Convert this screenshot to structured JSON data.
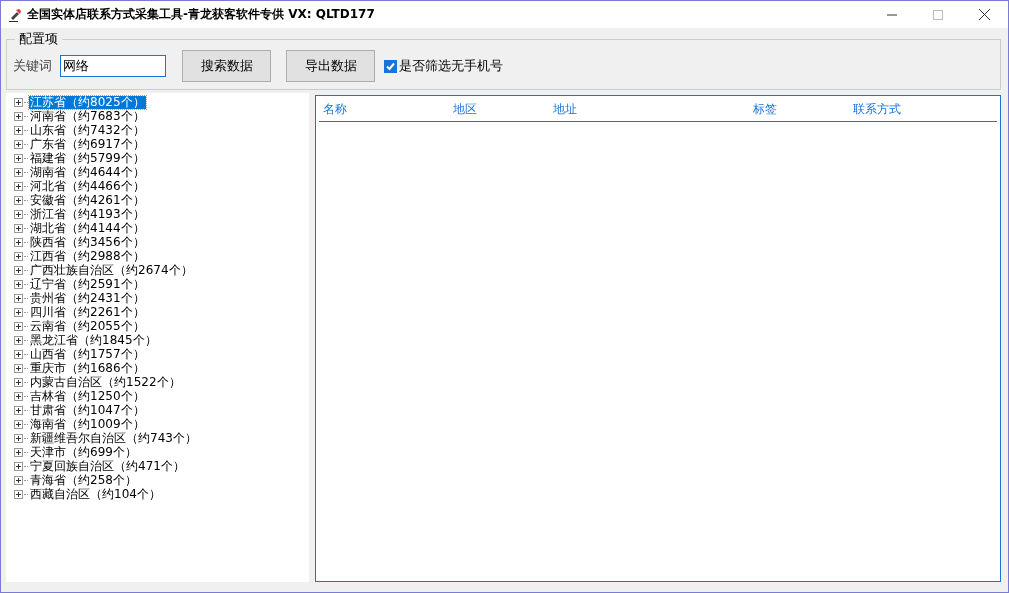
{
  "window": {
    "title": "全国实体店联系方式采集工具-青龙获客软件专供 VX:  QLTD177"
  },
  "config": {
    "title": "配置项",
    "keyword_label": "关键词",
    "keyword_value": "网络",
    "buttons": [
      "搜索数据",
      "导出数据"
    ],
    "filter": {
      "label": "是否筛选无手机号",
      "checked": true
    }
  },
  "tree": {
    "items": [
      {
        "label": "江苏省（约8025个）",
        "selected": true
      },
      {
        "label": "河南省（约7683个）",
        "selected": false
      },
      {
        "label": "山东省（约7432个）",
        "selected": false
      },
      {
        "label": "广东省（约6917个）",
        "selected": false
      },
      {
        "label": "福建省（约5799个）",
        "selected": false
      },
      {
        "label": "湖南省（约4644个）",
        "selected": false
      },
      {
        "label": "河北省（约4466个）",
        "selected": false
      },
      {
        "label": "安徽省（约4261个）",
        "selected": false
      },
      {
        "label": "浙江省（约4193个）",
        "selected": false
      },
      {
        "label": "湖北省（约4144个）",
        "selected": false
      },
      {
        "label": "陕西省（约3456个）",
        "selected": false
      },
      {
        "label": "江西省（约2988个）",
        "selected": false
      },
      {
        "label": "广西壮族自治区（约2674个）",
        "selected": false
      },
      {
        "label": "辽宁省（约2591个）",
        "selected": false
      },
      {
        "label": "贵州省（约2431个）",
        "selected": false
      },
      {
        "label": "四川省（约2261个）",
        "selected": false
      },
      {
        "label": "云南省（约2055个）",
        "selected": false
      },
      {
        "label": "黑龙江省（约1845个）",
        "selected": false
      },
      {
        "label": "山西省（约1757个）",
        "selected": false
      },
      {
        "label": "重庆市（约1686个）",
        "selected": false
      },
      {
        "label": "内蒙古自治区（约1522个）",
        "selected": false
      },
      {
        "label": "吉林省（约1250个）",
        "selected": false
      },
      {
        "label": "甘肃省（约1047个）",
        "selected": false
      },
      {
        "label": "海南省（约1009个）",
        "selected": false
      },
      {
        "label": "新疆维吾尔自治区（约743个）",
        "selected": false
      },
      {
        "label": "天津市（约699个）",
        "selected": false
      },
      {
        "label": "宁夏回族自治区（约471个）",
        "selected": false
      },
      {
        "label": "青海省（约258个）",
        "selected": false
      },
      {
        "label": "西藏自治区（约104个）",
        "selected": false
      }
    ]
  },
  "table": {
    "columns": [
      "名称",
      "地区",
      "地址",
      "标签",
      "联系方式"
    ]
  }
}
